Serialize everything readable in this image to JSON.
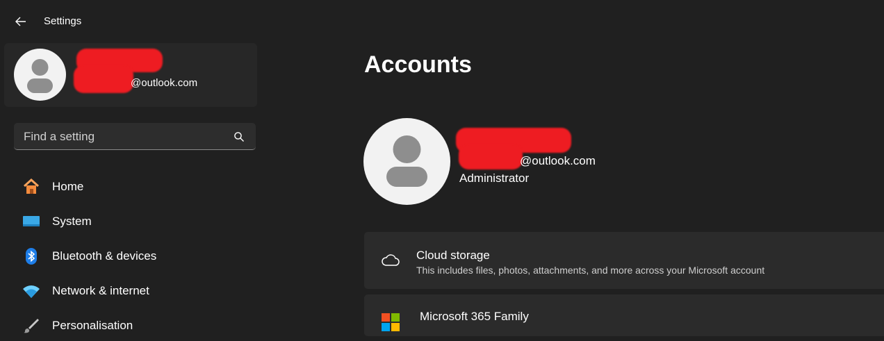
{
  "window": {
    "title": "Settings"
  },
  "profile": {
    "email_suffix": "@outlook.com"
  },
  "search": {
    "placeholder": "Find a setting"
  },
  "nav": {
    "items": [
      {
        "label": "Home",
        "icon": "home-icon"
      },
      {
        "label": "System",
        "icon": "system-icon"
      },
      {
        "label": "Bluetooth & devices",
        "icon": "bluetooth-icon"
      },
      {
        "label": "Network & internet",
        "icon": "wifi-icon"
      },
      {
        "label": "Personalisation",
        "icon": "brush-icon"
      }
    ]
  },
  "main": {
    "title": "Accounts",
    "account": {
      "email_suffix": "@outlook.com",
      "role": "Administrator"
    },
    "cards": [
      {
        "title": "Cloud storage",
        "subtitle": "This includes files, photos, attachments, and more across your Microsoft account",
        "icon": "cloud-icon"
      },
      {
        "title": "Microsoft 365 Family",
        "icon": "microsoft-logo-icon"
      }
    ]
  },
  "colors": {
    "background": "#202020",
    "card": "#2b2b2b",
    "redaction": "#ee1c22",
    "accent": "#4cc2ff"
  }
}
